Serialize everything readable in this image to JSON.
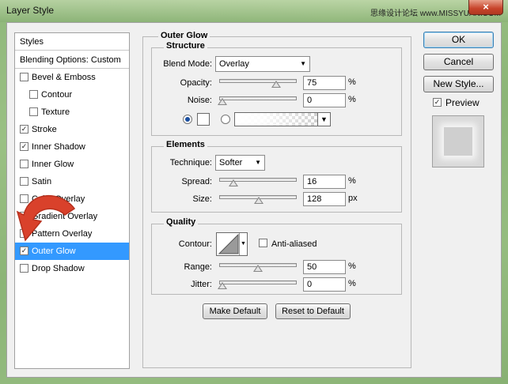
{
  "window": {
    "title": "Layer Style",
    "watermark": "思缘设计论坛  www.MISSYUAN.COM",
    "close_glyph": "×"
  },
  "styles_list": {
    "header": "Styles",
    "blending": "Blending Options: Custom",
    "items": [
      {
        "label": "Bevel & Emboss",
        "checked": false,
        "indent": false
      },
      {
        "label": "Contour",
        "checked": false,
        "indent": true
      },
      {
        "label": "Texture",
        "checked": false,
        "indent": true
      },
      {
        "label": "Stroke",
        "checked": true,
        "indent": false
      },
      {
        "label": "Inner Shadow",
        "checked": true,
        "indent": false
      },
      {
        "label": "Inner Glow",
        "checked": false,
        "indent": false
      },
      {
        "label": "Satin",
        "checked": false,
        "indent": false
      },
      {
        "label": "Color Overlay",
        "checked": false,
        "indent": false
      },
      {
        "label": "Gradient Overlay",
        "checked": false,
        "indent": false
      },
      {
        "label": "Pattern Overlay",
        "checked": false,
        "indent": false
      },
      {
        "label": "Outer Glow",
        "checked": true,
        "indent": false,
        "selected": true
      },
      {
        "label": "Drop Shadow",
        "checked": false,
        "indent": false
      }
    ],
    "check_glyph": "✓"
  },
  "panel": {
    "title": "Outer Glow",
    "structure": {
      "title": "Structure",
      "blend_mode_label": "Blend Mode:",
      "blend_mode_value": "Overlay",
      "opacity_label": "Opacity:",
      "opacity_value": "75",
      "opacity_unit": "%",
      "opacity_level": 0.75,
      "noise_label": "Noise:",
      "noise_value": "0",
      "noise_unit": "%",
      "noise_level": 0.0
    },
    "elements": {
      "title": "Elements",
      "technique_label": "Technique:",
      "technique_value": "Softer",
      "spread_label": "Spread:",
      "spread_value": "16",
      "spread_unit": "%",
      "spread_level": 0.16,
      "size_label": "Size:",
      "size_value": "128",
      "size_unit": "px",
      "size_level": 0.51
    },
    "quality": {
      "title": "Quality",
      "contour_label": "Contour:",
      "anti_aliased_label": "Anti-aliased",
      "range_label": "Range:",
      "range_value": "50",
      "range_unit": "%",
      "range_level": 0.5,
      "jitter_label": "Jitter:",
      "jitter_value": "0",
      "jitter_unit": "%",
      "jitter_level": 0.0
    },
    "make_default": "Make Default",
    "reset_default": "Reset to Default"
  },
  "actions": {
    "ok": "OK",
    "cancel": "Cancel",
    "new_style": "New Style...",
    "preview_label": "Preview",
    "preview_checked": true
  },
  "arrow_glyph": "▼"
}
